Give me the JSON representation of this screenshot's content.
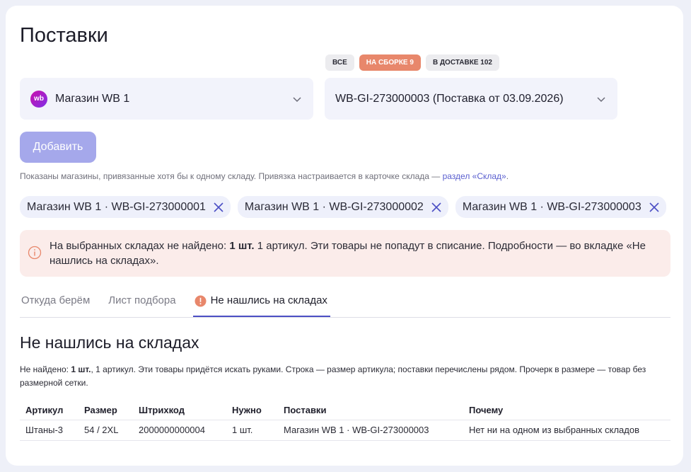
{
  "page": {
    "title": "Поставки"
  },
  "filters": [
    {
      "label": "ВСЕ"
    },
    {
      "label": "НА СБОРКЕ 9"
    },
    {
      "label": "В ДОСТАВКЕ 102"
    }
  ],
  "shop_select": {
    "logo_text": "wb",
    "value": "Магазин WB 1"
  },
  "supply_select": {
    "value": "WB-GI-273000003 (Поставка от 03.09.2026)"
  },
  "add_button": {
    "label": "Добавить"
  },
  "hint": {
    "text": "Показаны магазины, привязанные хотя бы к одному складу. Привязка настраивается в карточке склада — ",
    "link": "раздел «Склад»",
    "suffix": "."
  },
  "selected_tags": [
    {
      "label": "Магазин WB 1 · WB-GI-273000001"
    },
    {
      "label": "Магазин WB 1 · WB-GI-273000002"
    },
    {
      "label": "Магазин WB 1 · WB-GI-273000003"
    }
  ],
  "alert": {
    "prefix": "На выбранных складах не найдено: ",
    "count": "1 шт.",
    "rest": " 1 артикул. Эти товары не попадут в списание. Подробности — во вкладке «Не нашлись на складах»."
  },
  "tabs": [
    {
      "label": "Откуда берём"
    },
    {
      "label": "Лист подбора"
    },
    {
      "label": "Не нашлись на складах"
    }
  ],
  "section": {
    "title": "Не нашлись на складах",
    "desc_prefix": "Не найдено: ",
    "desc_count": "1 шт.",
    "desc_rest": ", 1 артикул. Эти товары придётся искать руками. Строка — размер артикула; поставки перечислены рядом. Прочерк в размере — товар без размерной сетки."
  },
  "table": {
    "headers": [
      "Артикул",
      "Размер",
      "Штрихкод",
      "Нужно",
      "Поставки",
      "Почему"
    ],
    "rows": [
      [
        "Штаны-3",
        "54 / 2XL",
        "2000000000004",
        "1 шт.",
        "Магазин WB 1 · WB-GI-273000003",
        "Нет ни на одном из выбранных складов"
      ]
    ]
  },
  "colors": {
    "accent": "#4c4fc4",
    "active_filter": "#e8876b",
    "alert_bg": "#fbecea",
    "button": "#a5a8eb"
  },
  "icons": {
    "shop_logo": "wb-logo-icon",
    "dropdown": "chevron-down-icon",
    "remove": "close-icon",
    "alert": "info-circle-icon",
    "tab_warning": "exclamation-circle-icon"
  }
}
